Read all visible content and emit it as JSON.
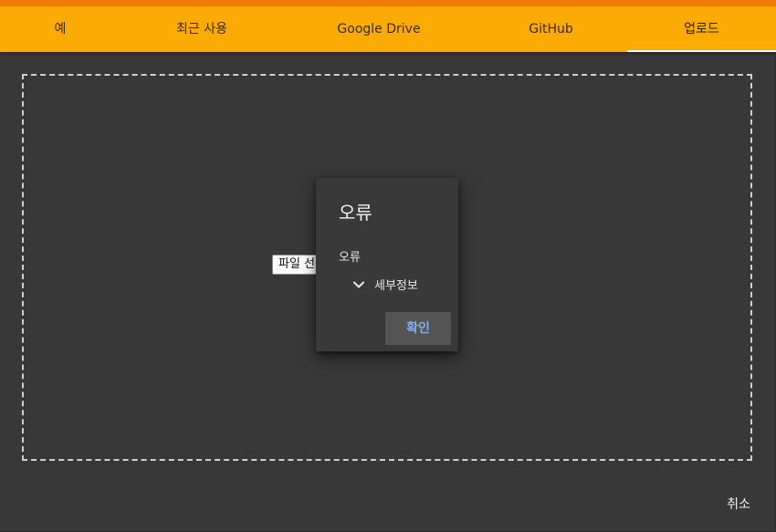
{
  "tabs": [
    {
      "label": "예"
    },
    {
      "label": "최근 사용"
    },
    {
      "label": "Google Drive"
    },
    {
      "label": "GitHub"
    },
    {
      "label": "업로드",
      "active": true
    }
  ],
  "upload": {
    "file_button_label": "파일 선택"
  },
  "dialog": {
    "title": "오류",
    "message": "오류",
    "details_label": "세부정보",
    "ok_label": "확인",
    "details_icon": "chevron-down-icon"
  },
  "footer": {
    "cancel_label": "취소"
  },
  "colors": {
    "tab_bar": "#fbab03",
    "top_accent": "#f07c0a",
    "background": "#383838",
    "dialog_background": "#393939",
    "ok_text": "#7fb2f0"
  }
}
